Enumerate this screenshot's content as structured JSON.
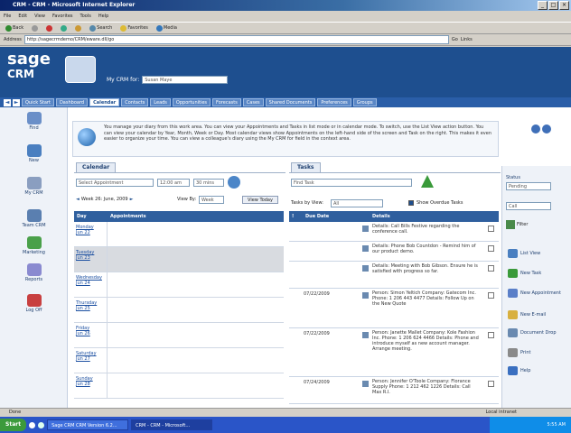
{
  "window": {
    "title": "CRM - CRM - Microsoft Internet Explorer"
  },
  "menu": [
    "File",
    "Edit",
    "View",
    "Favorites",
    "Tools",
    "Help"
  ],
  "toolbar": {
    "back": "Back",
    "search": "Search",
    "favorites": "Favorites",
    "media": "Media"
  },
  "address": {
    "label": "Address",
    "url": "http://sagecrmdemo/CRM/eware.dll/go",
    "go": "Go",
    "links": "Links"
  },
  "header": {
    "logo_top": "sage",
    "logo_bottom": "CRM",
    "mycrm_label": "My CRM for:",
    "mycrm_user": "Susan Maye"
  },
  "tabs": [
    "Quick Start",
    "Dashboard",
    "Calendar",
    "Contacts",
    "Leads",
    "Opportunities",
    "Forecasts",
    "Cases",
    "Shared Documents",
    "Preferences",
    "Groups"
  ],
  "active_tab": "Calendar",
  "leftnav": [
    {
      "label": "Find",
      "color": "#6a8fc8"
    },
    {
      "label": "New",
      "color": "#4a7fc0"
    },
    {
      "label": "My CRM",
      "color": "#8a9ec0"
    },
    {
      "label": "Team CRM",
      "color": "#5a7fb0"
    },
    {
      "label": "Marketing",
      "color": "#4aa04a"
    },
    {
      "label": "Reports",
      "color": "#8a8ad0"
    },
    {
      "label": "Log Off",
      "color": "#c84040"
    }
  ],
  "info": "You manage your diary from this work area. You can view your Appointments and Tasks in list mode or in calendar mode. To switch, use the List View action button. You can view your calendar by Year, Month, Week or Day. Most calendar views show Appointments on the left-hand side of the screen and Task on the right. This makes it even easier to organize your time. You can view a colleague's diary using the My CRM for field in the context area.",
  "calendar": {
    "tab_label": "Calendar",
    "appt_field": "Select Appointment",
    "time_from": "12:00 am",
    "time_to": "30 mins",
    "week_label": "Week 26: June, 2009",
    "viewby_label": "View By:",
    "viewby_value": "Week",
    "today_btn": "View Today",
    "col_day": "Day",
    "col_appointments": "Appointments",
    "days": [
      {
        "name": "Monday",
        "date": "Jun 22"
      },
      {
        "name": "Tuesday",
        "date": "Jun 23"
      },
      {
        "name": "Wednesday",
        "date": "Jun 24"
      },
      {
        "name": "Thursday",
        "date": "Jun 25"
      },
      {
        "name": "Friday",
        "date": "Jun 26"
      },
      {
        "name": "Saturday",
        "date": "Jun 27"
      },
      {
        "name": "Sunday",
        "date": "Jun 28"
      }
    ]
  },
  "tasks": {
    "tab_label": "Tasks",
    "task_field": "Find Task",
    "tasksby_label": "Tasks by View:",
    "tasksby_value": "All",
    "overdue_label": "Show Overdue Tasks",
    "col_due": "Due Date",
    "col_details": "Details",
    "rows": [
      {
        "date": "",
        "detail": "Details: Call Bills Festive regarding the conference call."
      },
      {
        "date": "",
        "detail": "Details: Phone Bob Countdon - Remind him of our product demo."
      },
      {
        "date": "",
        "detail": "Details: Meeting with Bob Gibson. Ensure he is satisfied with progress so far."
      },
      {
        "date": "07/22/2009",
        "detail": "Person: Simon Yeltich Company: Gatecom Inc. Phone: 1 206 443 4477 Details: Follow Up on the New Quote"
      },
      {
        "date": "07/22/2009",
        "detail": "Person: Janette Mallet Company: Kole Fashion Inc. Phone: 1 206 624 4466 Details: Phone and introduce myself as new account manager. Arrange meeting."
      },
      {
        "date": "07/24/2009",
        "detail": "Person: Jennifer O'Toole Company: Florance Supply Phone: 1 212 462 1226 Details: Call Max R.I."
      }
    ]
  },
  "right": {
    "status_label": "Status",
    "status_value": "Pending",
    "type_value": "Call",
    "filter": "Filter",
    "actions": [
      "List View",
      "New Task",
      "New Appointment",
      "New E-mail",
      "Document Drop",
      "Print",
      "Help"
    ]
  },
  "statusbar": {
    "left": "Done",
    "right": "Local intranet"
  },
  "taskbar": {
    "start": "Start",
    "items": [
      "Sage CRM CRM Version 6.2...",
      "CRM - CRM - Microsoft..."
    ],
    "time": "5:55 AM"
  },
  "colors": {
    "header": "#1e4f8f",
    "tabbar": "#2a5ea8",
    "table_head": "#2f5f9e"
  }
}
